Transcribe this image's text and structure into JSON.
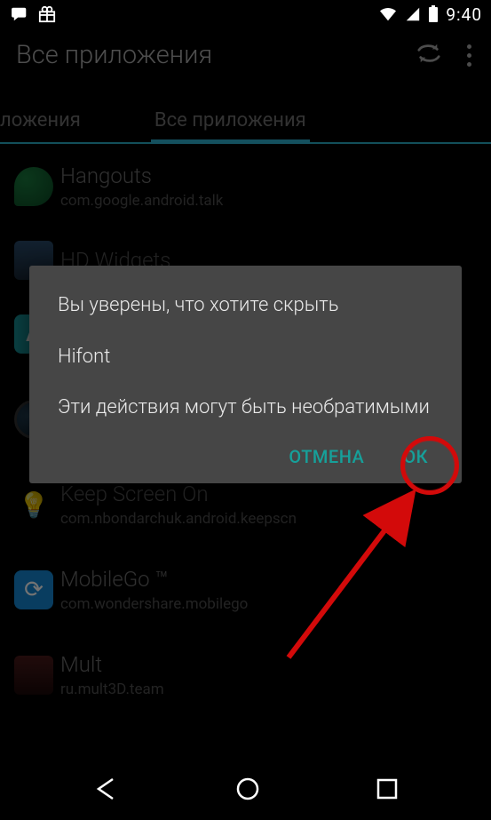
{
  "status": {
    "time": "9:40"
  },
  "header": {
    "title": "Все приложения"
  },
  "tabs": {
    "left": "риложения",
    "active": "Все приложения"
  },
  "apps": [
    {
      "name": "Hangouts",
      "pkg": "com.google.android.talk"
    },
    {
      "name": "HD Widgets",
      "pkg": ""
    },
    {
      "name": "Hifont",
      "pkg": ""
    },
    {
      "name": "",
      "pkg": ""
    },
    {
      "name": "Keep Screen On",
      "pkg": "com.nbondarchuk.android.keepscn"
    },
    {
      "name": "MobileGo ™",
      "pkg": "com.wondershare.mobilego"
    },
    {
      "name": "Mult",
      "pkg": "ru.mult3D.team"
    }
  ],
  "dialog": {
    "line1": "Вы уверены, что хотите скрыть",
    "line2": "Hifont",
    "line3": "Эти действия могут быть необратимыми",
    "cancel": "ОТМЕНА",
    "ok": "ОК"
  },
  "colors": {
    "accent": "#2eb2d0",
    "dialog_action": "#16a09a",
    "annotation": "#d30a0a"
  }
}
